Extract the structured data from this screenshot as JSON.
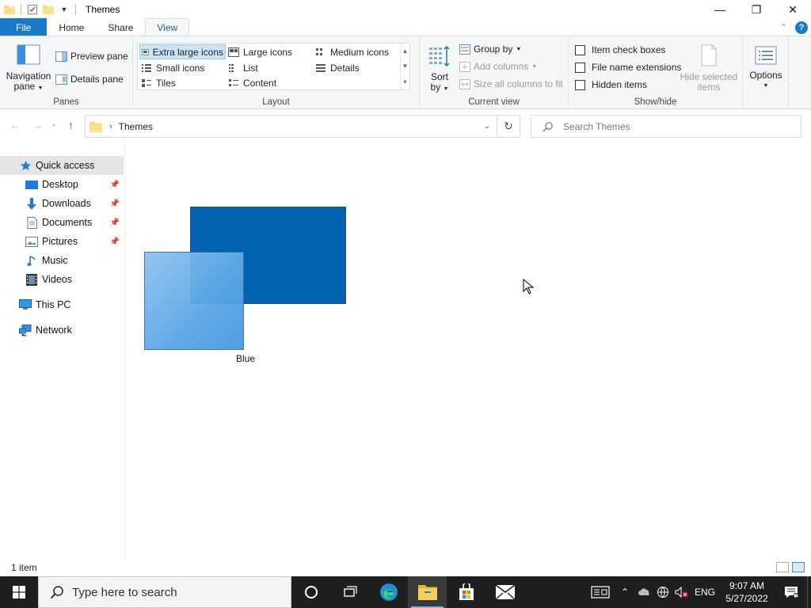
{
  "window": {
    "title": "Themes",
    "controls": {
      "minimize": "—",
      "restore": "❐",
      "close": "✕"
    }
  },
  "ribbon": {
    "tabs": [
      {
        "label": "File"
      },
      {
        "label": "Home"
      },
      {
        "label": "Share"
      },
      {
        "label": "View"
      }
    ],
    "panes": {
      "navigation_pane_line1": "Navigation",
      "navigation_pane_line2": "pane",
      "preview_pane": "Preview pane",
      "details_pane": "Details pane",
      "group_label": "Panes"
    },
    "layout": {
      "items": [
        "Extra large icons",
        "Large icons",
        "Medium icons",
        "Small icons",
        "List",
        "Details",
        "Tiles",
        "Content"
      ],
      "group_label": "Layout"
    },
    "current_view": {
      "sort_by_line1": "Sort",
      "sort_by_line2": "by",
      "group_by": "Group by",
      "add_columns": "Add columns",
      "size_columns": "Size all columns to fit",
      "group_label": "Current view"
    },
    "show_hide": {
      "item_check_boxes": "Item check boxes",
      "file_name_extensions": "File name extensions",
      "hidden_items": "Hidden items",
      "hide_selected_line1": "Hide selected",
      "hide_selected_line2": "items",
      "group_label": "Show/hide"
    },
    "options": {
      "label": "Options"
    }
  },
  "address": {
    "path": "Themes",
    "search_placeholder": "Search Themes"
  },
  "nav": {
    "items": [
      {
        "label": "Quick access",
        "icon": "star-icon"
      },
      {
        "label": "Desktop",
        "icon": "desktop-icon",
        "pinned": true
      },
      {
        "label": "Downloads",
        "icon": "download-icon",
        "pinned": true
      },
      {
        "label": "Documents",
        "icon": "document-icon",
        "pinned": true
      },
      {
        "label": "Pictures",
        "icon": "pictures-icon",
        "pinned": true
      },
      {
        "label": "Music",
        "icon": "music-icon"
      },
      {
        "label": "Videos",
        "icon": "video-icon"
      },
      {
        "label": "This PC",
        "icon": "computer-icon"
      },
      {
        "label": "Network",
        "icon": "network-icon"
      }
    ]
  },
  "content": {
    "items": [
      {
        "label": "Blue"
      }
    ]
  },
  "status": {
    "count": "1 item"
  },
  "taskbar": {
    "search_placeholder": "Type here to search",
    "language": "ENG",
    "time": "9:07 AM",
    "date": "5/27/2022"
  },
  "colors": {
    "accent": "#1979ca",
    "theme_dark_blue": "#0063b1",
    "theme_light_blue": "#7fb8ea",
    "selection": "#cce4f7"
  }
}
